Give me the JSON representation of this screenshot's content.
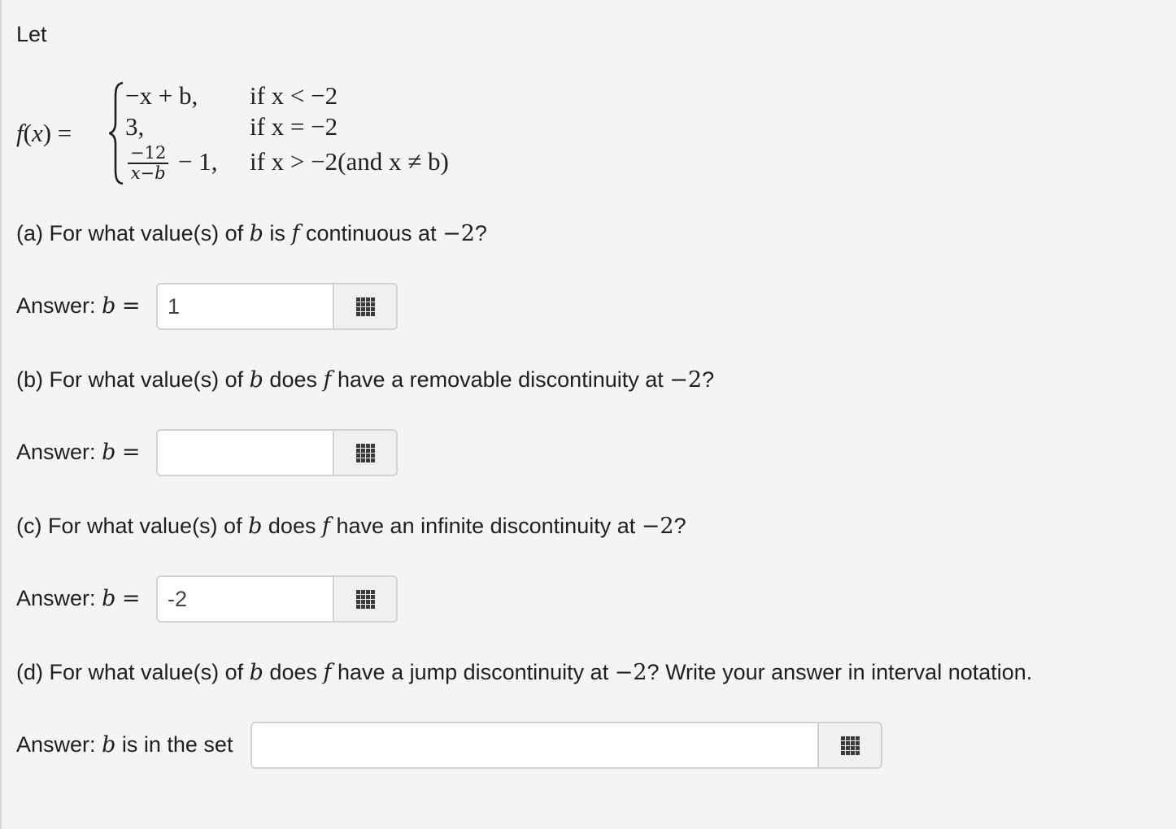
{
  "intro": "Let",
  "function": {
    "lhs_f": "f",
    "lhs_x": "x",
    "cases": [
      {
        "expr": "−x + b,",
        "cond": "if x < −2"
      },
      {
        "expr": "3,",
        "cond": "if x = −2"
      },
      {
        "numerator": "−12",
        "denominator": "x−b",
        "expr_tail": "− 1,",
        "cond": "if x > −2(and x ≠ b)"
      }
    ]
  },
  "parts": [
    {
      "question_prefix": "(a) For what value(s) of",
      "question_mid": "is",
      "question_rest": "continuous at",
      "point": "−2",
      "question_end": "?",
      "answer_label": "Answer:",
      "answer_var": "b",
      "answer_eq": "=",
      "value": "1"
    },
    {
      "question_prefix": "(b) For what value(s) of",
      "question_mid": "does",
      "question_rest": "have a removable discontinuity at",
      "point": "−2",
      "question_end": "?",
      "answer_label": "Answer:",
      "answer_var": "b",
      "answer_eq": "=",
      "value": ""
    },
    {
      "question_prefix": "(c) For what value(s) of",
      "question_mid": "does",
      "question_rest": "have an infinite discontinuity at",
      "point": "−2",
      "question_end": "?",
      "answer_label": "Answer:",
      "answer_var": "b",
      "answer_eq": "=",
      "value": "-2"
    },
    {
      "question_prefix": "(d) For what value(s) of",
      "question_mid": "does",
      "question_rest": "have a jump discontinuity at",
      "point": "−2",
      "question_end": "? Write your answer in interval notation.",
      "answer_label": "Answer:",
      "answer_var": "b",
      "answer_tail": "is in the set",
      "value": ""
    }
  ],
  "symbols": {
    "b": "b",
    "f": "f"
  },
  "icons": {
    "keyboard": "keyboard-grid-icon"
  }
}
